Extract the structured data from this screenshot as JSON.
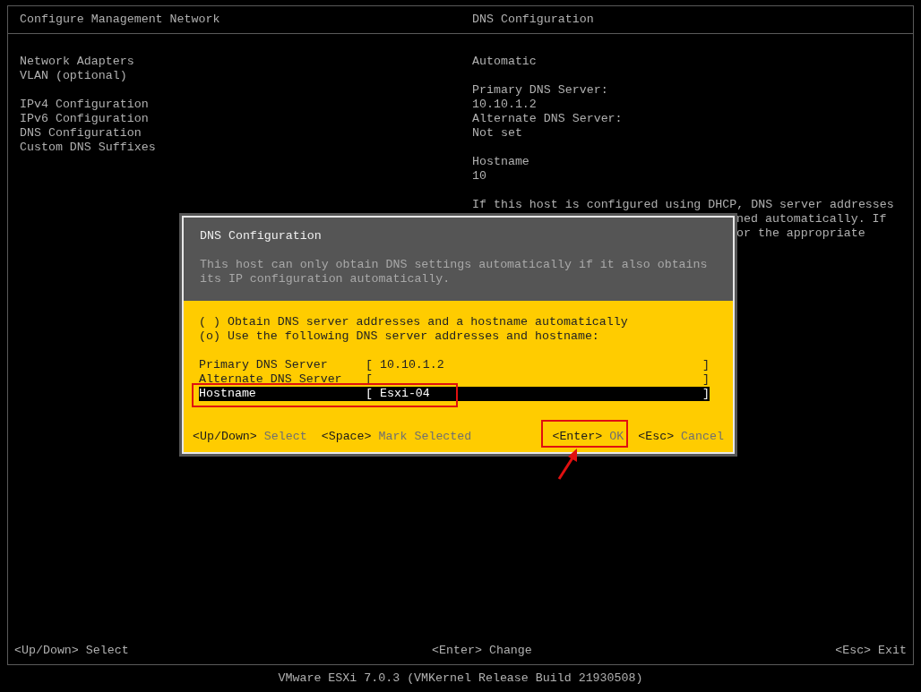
{
  "left_panel": {
    "title": "Configure Management Network",
    "menu_groups": [
      [
        {
          "label": "Network Adapters"
        },
        {
          "label": "VLAN (optional)"
        }
      ],
      [
        {
          "label": "IPv4 Configuration"
        },
        {
          "label": "IPv6 Configuration"
        },
        {
          "label": "DNS Configuration"
        },
        {
          "label": "Custom DNS Suffixes"
        }
      ]
    ]
  },
  "right_panel": {
    "title": "DNS Configuration",
    "groups": [
      [
        "Automatic"
      ],
      [
        "Primary DNS Server:",
        "10.10.1.2",
        "Alternate DNS Server:",
        "Not set"
      ],
      [
        "Hostname",
        "10"
      ]
    ],
    "description_lines": [
      {
        "text": "If this host is configured using DHCP, DNS server addresses",
        "covered": false
      },
      {
        "text": "ned automatically. If",
        "covered": true
      },
      {
        "text": "or the appropriate",
        "covered": true
      }
    ]
  },
  "dialog": {
    "title": "DNS Configuration",
    "message": [
      "This host can only obtain DNS settings automatically if it also obtains",
      "its IP configuration automatically."
    ],
    "radio_glyph": "o",
    "radio_brackets": [
      "(",
      ")"
    ],
    "options": [
      {
        "label": "Obtain DNS server addresses and a hostname automatically",
        "selected": false
      },
      {
        "label": "Use the following DNS server addresses and hostname:",
        "selected": true
      }
    ],
    "field_brackets": [
      "[",
      "]"
    ],
    "fields": [
      {
        "label": "Primary DNS Server",
        "value": "10.10.1.2",
        "selected": false
      },
      {
        "label": "Alternate DNS Server",
        "selected": false
      },
      {
        "label": "Hostname",
        "value": "Esxi-04",
        "selected": true
      }
    ],
    "keys_left": [
      {
        "key": "<Up/Down>",
        "action": "Select"
      },
      {
        "key": "<Space>",
        "action": "Mark Selected"
      }
    ],
    "keys_right": [
      {
        "key": "<Enter>",
        "action": "OK"
      },
      {
        "key": "<Esc>",
        "action": "Cancel"
      }
    ]
  },
  "bottom_bar": [
    {
      "key": "<Up/Down>",
      "action": "Select"
    },
    {
      "key": "<Enter>",
      "action": "Change"
    },
    {
      "key": "<Esc>",
      "action": "Exit"
    }
  ],
  "version": "VMware ESXi 7.0.3 (VMKernel Release Build 21930508)"
}
